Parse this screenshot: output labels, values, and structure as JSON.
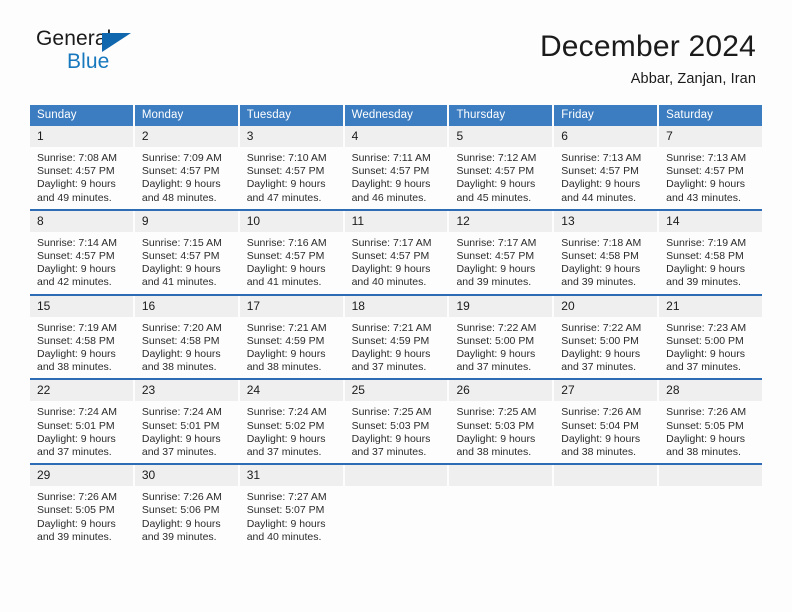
{
  "logo": {
    "word1": "General",
    "word2": "Blue",
    "triangle_color": "#1167ae",
    "blue_text_color": "#1878be"
  },
  "header": {
    "title": "December 2024",
    "subtitle": "Abbar, Zanjan, Iran",
    "accent_color": "#3c7cc0",
    "row_divider_color": "#2d6cb4",
    "daynum_background": "#efefef"
  },
  "weekday_headers": [
    "Sunday",
    "Monday",
    "Tuesday",
    "Wednesday",
    "Thursday",
    "Friday",
    "Saturday"
  ],
  "weeks": [
    [
      {
        "day": "1",
        "sunrise": "Sunrise: 7:08 AM",
        "sunset": "Sunset: 4:57 PM",
        "daylight1": "Daylight: 9 hours",
        "daylight2": "and 49 minutes."
      },
      {
        "day": "2",
        "sunrise": "Sunrise: 7:09 AM",
        "sunset": "Sunset: 4:57 PM",
        "daylight1": "Daylight: 9 hours",
        "daylight2": "and 48 minutes."
      },
      {
        "day": "3",
        "sunrise": "Sunrise: 7:10 AM",
        "sunset": "Sunset: 4:57 PM",
        "daylight1": "Daylight: 9 hours",
        "daylight2": "and 47 minutes."
      },
      {
        "day": "4",
        "sunrise": "Sunrise: 7:11 AM",
        "sunset": "Sunset: 4:57 PM",
        "daylight1": "Daylight: 9 hours",
        "daylight2": "and 46 minutes."
      },
      {
        "day": "5",
        "sunrise": "Sunrise: 7:12 AM",
        "sunset": "Sunset: 4:57 PM",
        "daylight1": "Daylight: 9 hours",
        "daylight2": "and 45 minutes."
      },
      {
        "day": "6",
        "sunrise": "Sunrise: 7:13 AM",
        "sunset": "Sunset: 4:57 PM",
        "daylight1": "Daylight: 9 hours",
        "daylight2": "and 44 minutes."
      },
      {
        "day": "7",
        "sunrise": "Sunrise: 7:13 AM",
        "sunset": "Sunset: 4:57 PM",
        "daylight1": "Daylight: 9 hours",
        "daylight2": "and 43 minutes."
      }
    ],
    [
      {
        "day": "8",
        "sunrise": "Sunrise: 7:14 AM",
        "sunset": "Sunset: 4:57 PM",
        "daylight1": "Daylight: 9 hours",
        "daylight2": "and 42 minutes."
      },
      {
        "day": "9",
        "sunrise": "Sunrise: 7:15 AM",
        "sunset": "Sunset: 4:57 PM",
        "daylight1": "Daylight: 9 hours",
        "daylight2": "and 41 minutes."
      },
      {
        "day": "10",
        "sunrise": "Sunrise: 7:16 AM",
        "sunset": "Sunset: 4:57 PM",
        "daylight1": "Daylight: 9 hours",
        "daylight2": "and 41 minutes."
      },
      {
        "day": "11",
        "sunrise": "Sunrise: 7:17 AM",
        "sunset": "Sunset: 4:57 PM",
        "daylight1": "Daylight: 9 hours",
        "daylight2": "and 40 minutes."
      },
      {
        "day": "12",
        "sunrise": "Sunrise: 7:17 AM",
        "sunset": "Sunset: 4:57 PM",
        "daylight1": "Daylight: 9 hours",
        "daylight2": "and 39 minutes."
      },
      {
        "day": "13",
        "sunrise": "Sunrise: 7:18 AM",
        "sunset": "Sunset: 4:58 PM",
        "daylight1": "Daylight: 9 hours",
        "daylight2": "and 39 minutes."
      },
      {
        "day": "14",
        "sunrise": "Sunrise: 7:19 AM",
        "sunset": "Sunset: 4:58 PM",
        "daylight1": "Daylight: 9 hours",
        "daylight2": "and 39 minutes."
      }
    ],
    [
      {
        "day": "15",
        "sunrise": "Sunrise: 7:19 AM",
        "sunset": "Sunset: 4:58 PM",
        "daylight1": "Daylight: 9 hours",
        "daylight2": "and 38 minutes."
      },
      {
        "day": "16",
        "sunrise": "Sunrise: 7:20 AM",
        "sunset": "Sunset: 4:58 PM",
        "daylight1": "Daylight: 9 hours",
        "daylight2": "and 38 minutes."
      },
      {
        "day": "17",
        "sunrise": "Sunrise: 7:21 AM",
        "sunset": "Sunset: 4:59 PM",
        "daylight1": "Daylight: 9 hours",
        "daylight2": "and 38 minutes."
      },
      {
        "day": "18",
        "sunrise": "Sunrise: 7:21 AM",
        "sunset": "Sunset: 4:59 PM",
        "daylight1": "Daylight: 9 hours",
        "daylight2": "and 37 minutes."
      },
      {
        "day": "19",
        "sunrise": "Sunrise: 7:22 AM",
        "sunset": "Sunset: 5:00 PM",
        "daylight1": "Daylight: 9 hours",
        "daylight2": "and 37 minutes."
      },
      {
        "day": "20",
        "sunrise": "Sunrise: 7:22 AM",
        "sunset": "Sunset: 5:00 PM",
        "daylight1": "Daylight: 9 hours",
        "daylight2": "and 37 minutes."
      },
      {
        "day": "21",
        "sunrise": "Sunrise: 7:23 AM",
        "sunset": "Sunset: 5:00 PM",
        "daylight1": "Daylight: 9 hours",
        "daylight2": "and 37 minutes."
      }
    ],
    [
      {
        "day": "22",
        "sunrise": "Sunrise: 7:24 AM",
        "sunset": "Sunset: 5:01 PM",
        "daylight1": "Daylight: 9 hours",
        "daylight2": "and 37 minutes."
      },
      {
        "day": "23",
        "sunrise": "Sunrise: 7:24 AM",
        "sunset": "Sunset: 5:01 PM",
        "daylight1": "Daylight: 9 hours",
        "daylight2": "and 37 minutes."
      },
      {
        "day": "24",
        "sunrise": "Sunrise: 7:24 AM",
        "sunset": "Sunset: 5:02 PM",
        "daylight1": "Daylight: 9 hours",
        "daylight2": "and 37 minutes."
      },
      {
        "day": "25",
        "sunrise": "Sunrise: 7:25 AM",
        "sunset": "Sunset: 5:03 PM",
        "daylight1": "Daylight: 9 hours",
        "daylight2": "and 37 minutes."
      },
      {
        "day": "26",
        "sunrise": "Sunrise: 7:25 AM",
        "sunset": "Sunset: 5:03 PM",
        "daylight1": "Daylight: 9 hours",
        "daylight2": "and 38 minutes."
      },
      {
        "day": "27",
        "sunrise": "Sunrise: 7:26 AM",
        "sunset": "Sunset: 5:04 PM",
        "daylight1": "Daylight: 9 hours",
        "daylight2": "and 38 minutes."
      },
      {
        "day": "28",
        "sunrise": "Sunrise: 7:26 AM",
        "sunset": "Sunset: 5:05 PM",
        "daylight1": "Daylight: 9 hours",
        "daylight2": "and 38 minutes."
      }
    ],
    [
      {
        "day": "29",
        "sunrise": "Sunrise: 7:26 AM",
        "sunset": "Sunset: 5:05 PM",
        "daylight1": "Daylight: 9 hours",
        "daylight2": "and 39 minutes."
      },
      {
        "day": "30",
        "sunrise": "Sunrise: 7:26 AM",
        "sunset": "Sunset: 5:06 PM",
        "daylight1": "Daylight: 9 hours",
        "daylight2": "and 39 minutes."
      },
      {
        "day": "31",
        "sunrise": "Sunrise: 7:27 AM",
        "sunset": "Sunset: 5:07 PM",
        "daylight1": "Daylight: 9 hours",
        "daylight2": "and 40 minutes."
      },
      {
        "day": "",
        "sunrise": "",
        "sunset": "",
        "daylight1": "",
        "daylight2": ""
      },
      {
        "day": "",
        "sunrise": "",
        "sunset": "",
        "daylight1": "",
        "daylight2": ""
      },
      {
        "day": "",
        "sunrise": "",
        "sunset": "",
        "daylight1": "",
        "daylight2": ""
      },
      {
        "day": "",
        "sunrise": "",
        "sunset": "",
        "daylight1": "",
        "daylight2": ""
      }
    ]
  ]
}
